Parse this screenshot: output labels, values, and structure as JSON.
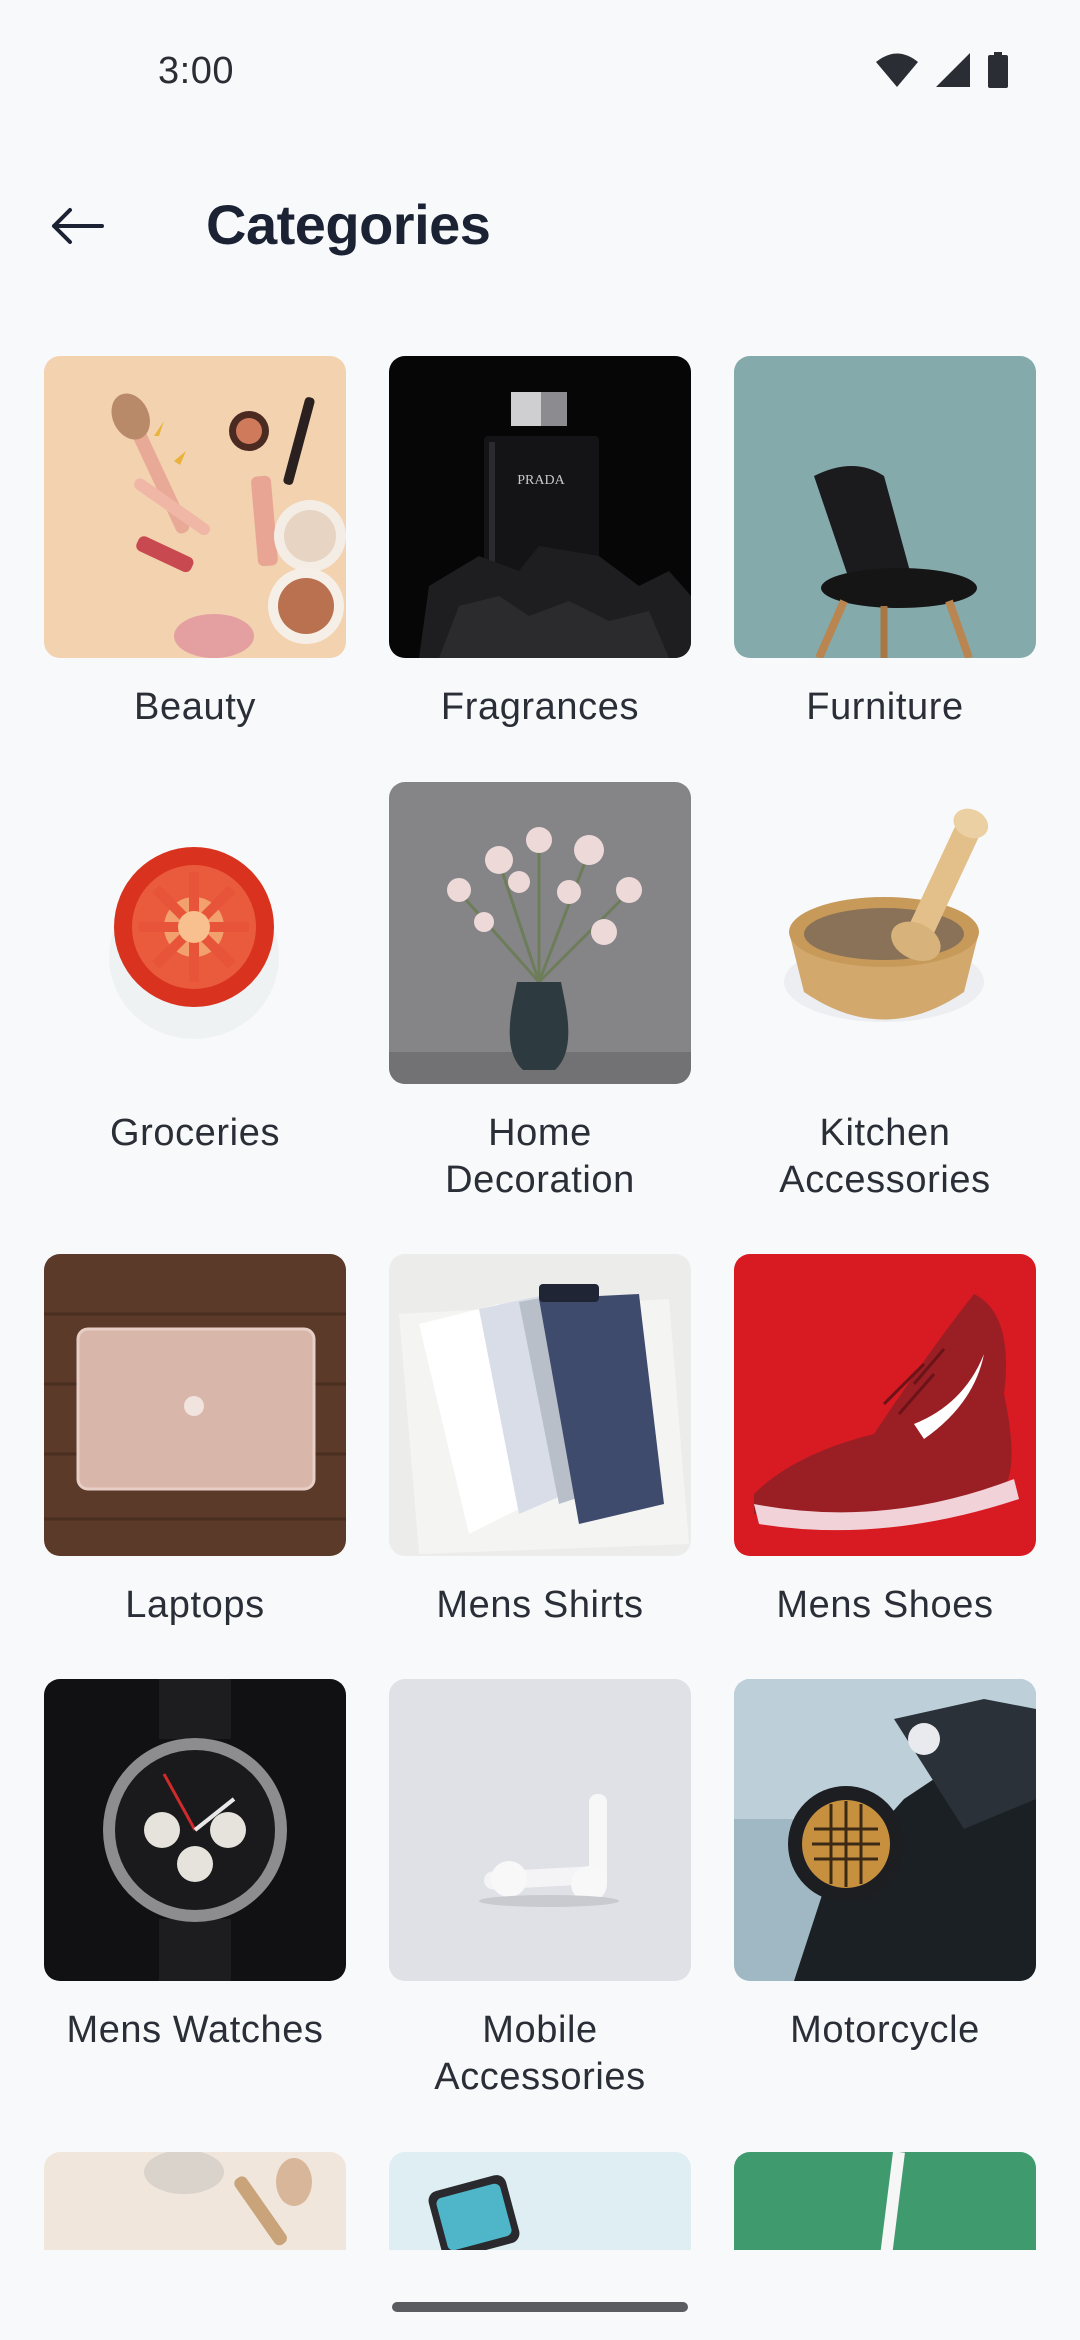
{
  "status_bar": {
    "time": "3:00",
    "icons": [
      "wifi-icon",
      "cellular-signal-icon",
      "battery-icon"
    ]
  },
  "header": {
    "back_icon": "arrow-left-icon",
    "title": "Categories"
  },
  "categories": [
    {
      "label": "Beauty"
    },
    {
      "label": "Fragrances"
    },
    {
      "label": "Furniture"
    },
    {
      "label": "Groceries"
    },
    {
      "label": "Home\nDecoration"
    },
    {
      "label": "Kitchen\nAccessories"
    },
    {
      "label": "Laptops"
    },
    {
      "label": "Mens Shirts"
    },
    {
      "label": "Mens Shoes"
    },
    {
      "label": "Mens Watches"
    },
    {
      "label": "Mobile\nAccessories"
    },
    {
      "label": "Motorcycle"
    }
  ],
  "colors": {
    "background": "#f8f9fb",
    "title": "#1b2233",
    "label": "#2a2e36"
  }
}
